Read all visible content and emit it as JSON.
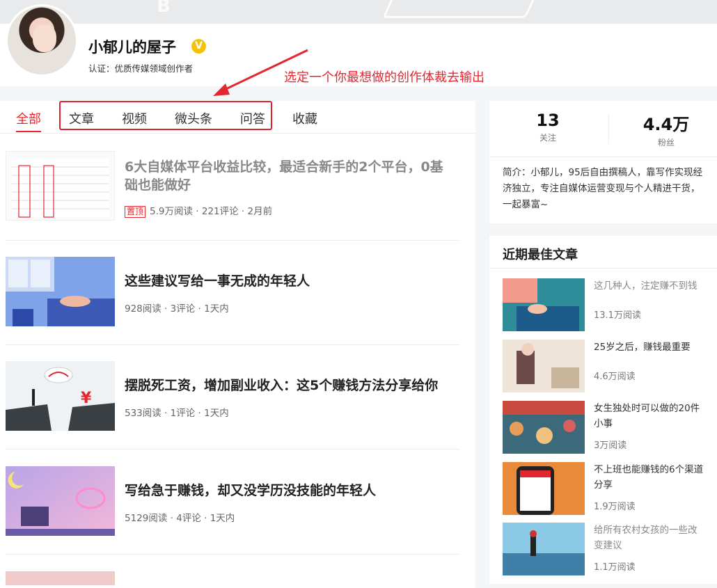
{
  "profile": {
    "name": "小郁儿的屋子",
    "cert": "认证：优质传媒领域创作者",
    "badge_icon": "verified-v-icon"
  },
  "annotation": "选定一个你最想做的创作体裁去输出",
  "tabs": [
    "全部",
    "文章",
    "视频",
    "微头条",
    "问答",
    "收藏"
  ],
  "articles": [
    {
      "title_line1": "6大自媒体平台收益比较，最适合新手的2个平台，0基",
      "title_line2": "础也能做好",
      "pin": "置顶",
      "meta": "5.9万阅读 · 221评论 · 2月前"
    },
    {
      "title": "这些建议写给一事无成的年轻人",
      "meta": "928阅读 · 3评论 · 1天内"
    },
    {
      "title": "摆脱死工资，增加副业收入：这5个赚钱方法分享给你",
      "meta": "533阅读 · 1评论 · 1天内"
    },
    {
      "title": "写给急于赚钱，却又没学历没技能的年轻人",
      "meta": "5129阅读 · 4评论 · 1天内"
    }
  ],
  "stats": {
    "following_num": "13",
    "following_label": "关注",
    "fans_num": "4.4万",
    "fans_label": "粉丝"
  },
  "intro_line1": "简介：小郁儿，95后自由撰稿人，靠写作实现经",
  "intro_line2": "济独立，专注自媒体运营变现与个人精进干货，",
  "intro_line3": "一起暴富~",
  "best": {
    "title": "近期最佳文章",
    "items": [
      {
        "line1": "这几种人，注定赚不到钱",
        "line2": "",
        "meta": "13.1万阅读"
      },
      {
        "line1": "25岁之后，赚钱最重要",
        "line2": "",
        "meta": "4.6万阅读"
      },
      {
        "line1": "女生独处时可以做的20件",
        "line2": "小事",
        "meta": "3万阅读"
      },
      {
        "line1": "不上班也能赚钱的6个渠道",
        "line2": "分享",
        "meta": "1.9万阅读"
      },
      {
        "line1": "给所有农村女孩的一些改",
        "line2": "变建议",
        "meta": "1.1万阅读"
      }
    ]
  },
  "colors": {
    "accent": "#e4262e",
    "verify": "#f5c20a"
  }
}
